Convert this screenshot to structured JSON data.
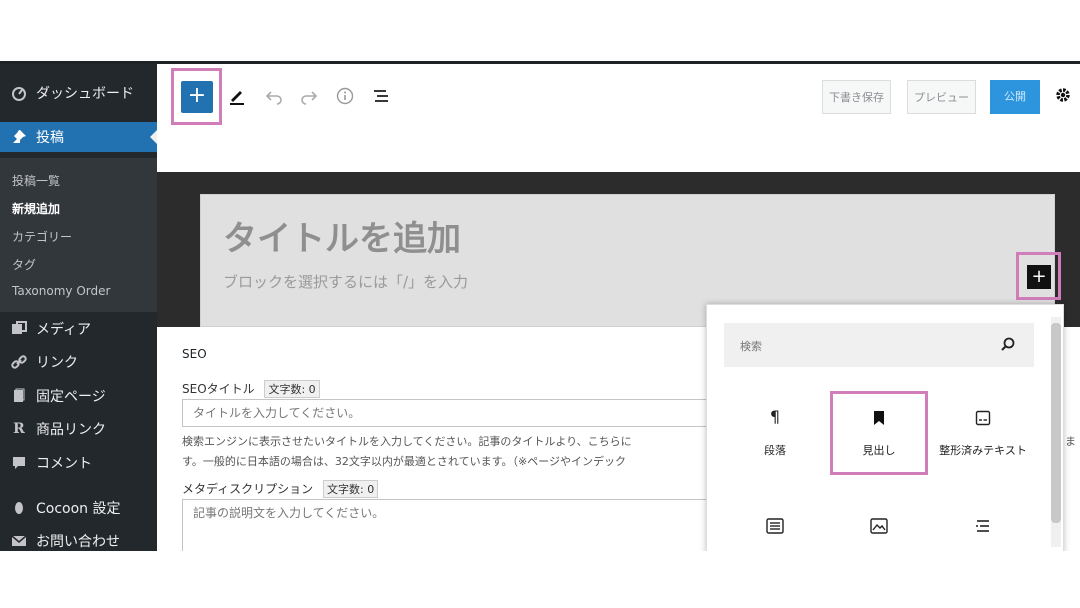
{
  "sidebar": {
    "dashboard": "ダッシュボード",
    "posts": "投稿",
    "submenu": [
      "投稿一覧",
      "新規追加",
      "カテゴリー",
      "タグ",
      "Taxonomy Order"
    ],
    "media": "メディア",
    "links": "リンク",
    "pages": "固定ページ",
    "product_links": "商品リンク",
    "comments": "コメント",
    "cocoon": "Cocoon 設定",
    "contact": "お問い合わせ"
  },
  "toolbar": {
    "save_draft": "下書き保存",
    "preview": "プレビュー",
    "publish": "公開"
  },
  "editor": {
    "title_placeholder": "タイトルを追加",
    "block_hint": "ブロックを選択するには「/」を入力"
  },
  "seo": {
    "section_title": "SEO",
    "title_label": "SEOタイトル",
    "char_count_label": "文字数: 0",
    "title_placeholder": "タイトルを入力してください。",
    "help_line1": "検索エンジンに表示させたいタイトルを入力してください。記事のタイトルより、こちらに",
    "help_line2": "す。一般的に日本語の場合は、32文字以内が最適とされています。（※ページやインデック",
    "help_overflow": "ま",
    "meta_label": "メタディスクリプション",
    "meta_count_label": "文字数: 0",
    "meta_placeholder": "記事の説明文を入力してください。"
  },
  "inserter": {
    "search_placeholder": "検索",
    "blocks": [
      {
        "label": "段落",
        "icon": "paragraph-icon"
      },
      {
        "label": "見出し",
        "icon": "heading-bookmark-icon"
      },
      {
        "label": "整形済みテキスト",
        "icon": "preformatted-icon"
      },
      {
        "label": "",
        "icon": "list-icon"
      },
      {
        "label": "",
        "icon": "image-icon"
      },
      {
        "label": "",
        "icon": "list-view-icon"
      }
    ]
  },
  "colors": {
    "sidebar_bg": "#23282d",
    "accent": "#2271b1",
    "highlight": "#d17db9"
  }
}
